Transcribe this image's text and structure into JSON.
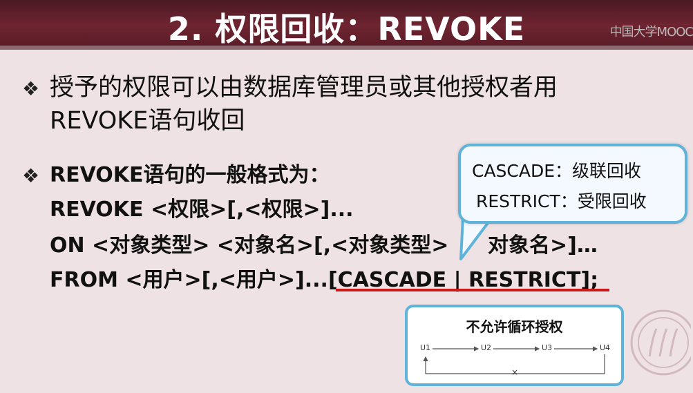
{
  "slide": {
    "title": "2. 权限回收：REVOKE",
    "watermark": "中国大学MOOC",
    "bullet_symbol": "❖",
    "bullet1_line1": "授予的权限可以由数据库管理员或其他授权者用",
    "bullet1_line2": "REVOKE语句收回",
    "bullet2": "REVOKE语句的一般格式为：",
    "syntax": [
      "REVOKE <权限>[,<权限>]...",
      "ON <对象类型> <对象名>[,<对象类型>",
      "对象名>]…",
      "FROM <用户>[,<用户>]...[CASCADE | RESTRICT];"
    ]
  },
  "callout": {
    "line1": "CASCADE：级联回收",
    "line2": "RESTRICT：受限回收"
  },
  "diagram": {
    "title": "不允许循环授权",
    "nodes": [
      "U1",
      "U2",
      "U3",
      "U4"
    ],
    "cross": "×"
  },
  "colors": {
    "header": "#6f2431",
    "background": "#efe2e5",
    "callout_border": "#5fb3d8",
    "underline": "#cc1a1a"
  }
}
